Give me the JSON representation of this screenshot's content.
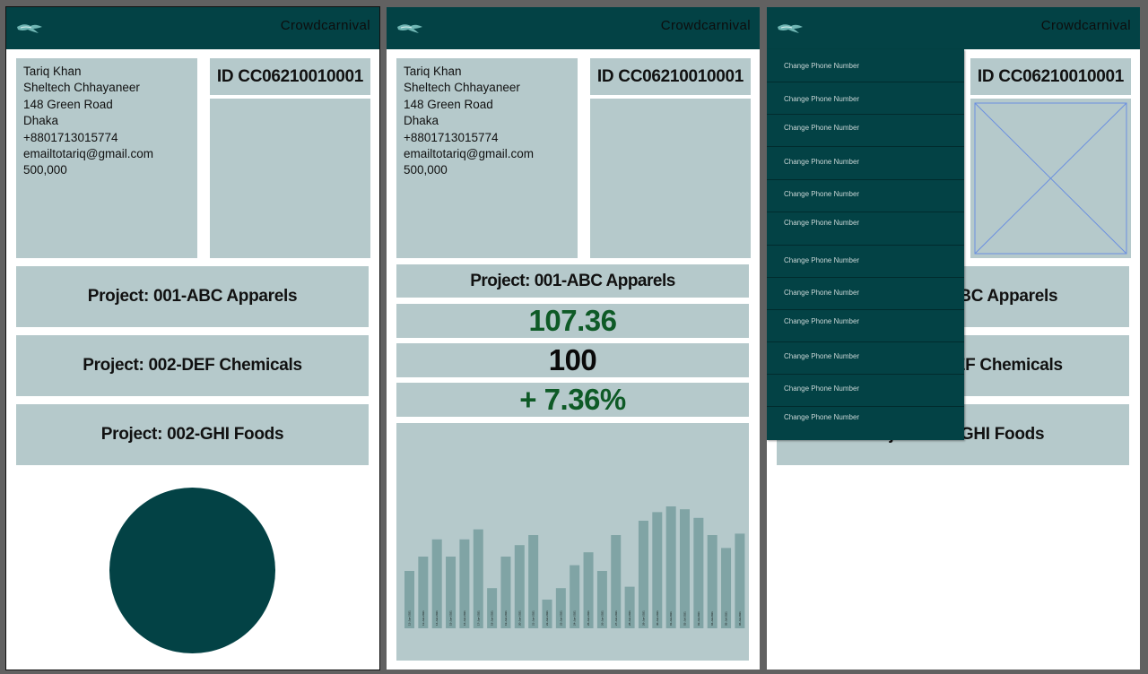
{
  "app": {
    "brand": "Crowdcarnival",
    "logo_icon": "bird-logo-icon",
    "colors": {
      "topbar": "#034245",
      "card": "#b5c9cb",
      "positive": "#0e6a2c",
      "bar": "#80a4a5"
    }
  },
  "profile": {
    "name": "Tariq Khan",
    "org": "Sheltech Chhayaneer",
    "street": "148 Green Road",
    "city": "Dhaka",
    "phone": "+8801713015774",
    "email": "emailtotariq@gmail.com",
    "amount": "500,000",
    "id_label": "ID CC06210010001"
  },
  "projects": [
    {
      "label": "Project: 001-ABC Apparels"
    },
    {
      "label": "Project: 002-DEF Chemicals"
    },
    {
      "label": "Project: 002-GHI Foods"
    }
  ],
  "project_detail": {
    "title": "Project: 001-ABC Apparels",
    "current_value": "107.36",
    "base_value": "100",
    "change": "+ 7.36%"
  },
  "chart_data": {
    "type": "bar",
    "title": "",
    "xlabel": "",
    "ylabel": "",
    "ylim": [
      0,
      100
    ],
    "categories": [
      "12-Jun-2021",
      "13-Jun-2021",
      "14-Jun-2021",
      "15-Jun-2021",
      "16-Jun-2021",
      "17-Jun-2021",
      "18-Jun-2021",
      "19-Jun-2021",
      "20-Jun-2021",
      "21-Jun-2021",
      "22-Jun-2021",
      "23-Jun-2021",
      "24-Jun-2021",
      "25-Jun-2021",
      "26-Jun-2021",
      "27-Jun-2021",
      "28-Jun-2021",
      "29-Jun-2021",
      "30-Jun-2021",
      "01-Jul-2021",
      "02-Jul-2021",
      "03-Jul-2021",
      "04-Jul-2021",
      "05-Jul-2021",
      "06-Jul-2021"
    ],
    "values": [
      40,
      50,
      62,
      50,
      62,
      69,
      28,
      50,
      58,
      65,
      20,
      28,
      44,
      53,
      40,
      65,
      29,
      75,
      81,
      85,
      83,
      77,
      65,
      56,
      66
    ]
  },
  "menu": {
    "items": [
      "Change Phone Number",
      "Change Phone Number",
      "Change Phone Number",
      "Change Phone Number",
      "Change Phone Number",
      "Change Phone Number",
      "Change Phone Number",
      "Change Phone Number",
      "Change Phone Number",
      "Change Phone Number",
      "Change Phone Number",
      "Change Phone Number"
    ]
  }
}
